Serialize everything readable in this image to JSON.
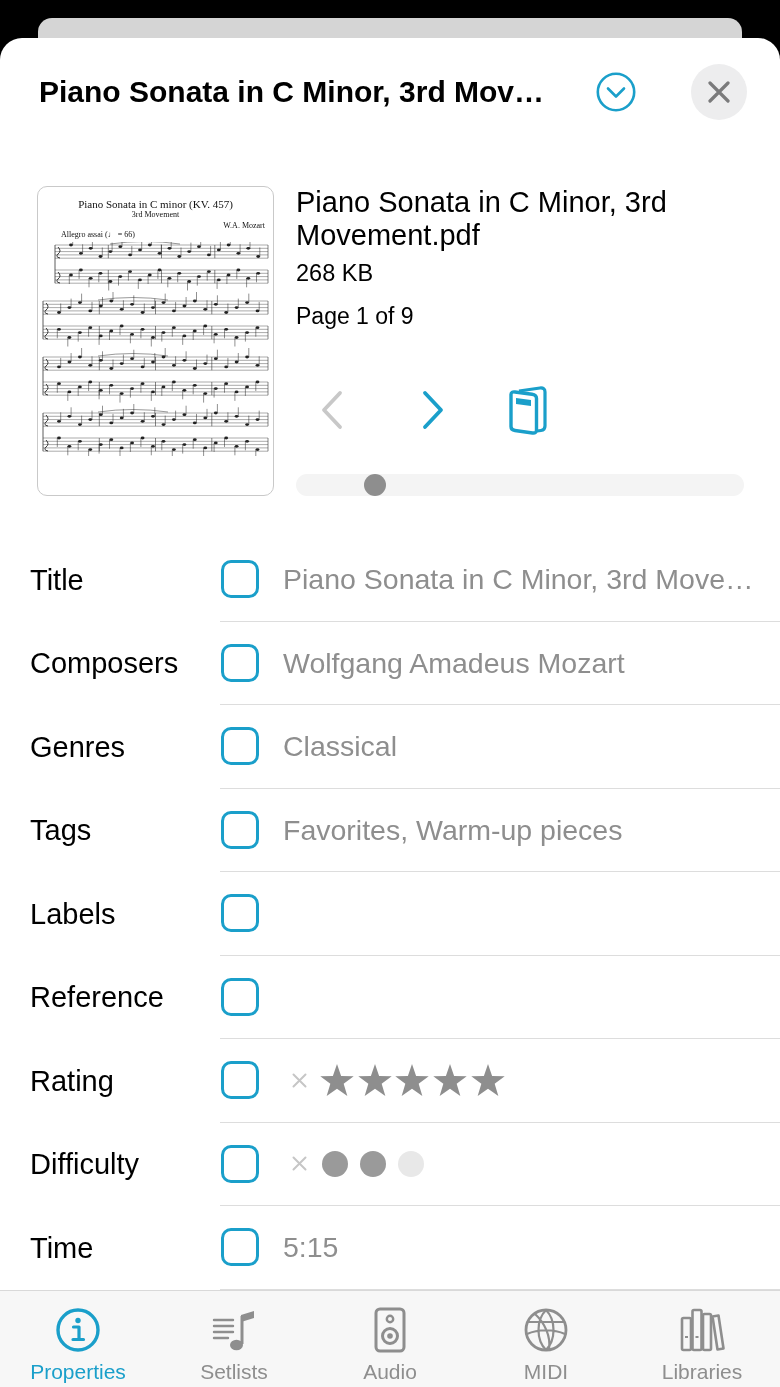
{
  "header": {
    "title": "Piano Sonata in C Minor, 3rd Mov…"
  },
  "document": {
    "thumbnail": {
      "title": "Piano Sonata in C minor (KV. 457)",
      "subtitle": "3rd Movement",
      "composer": "W.A. Mozart",
      "tempo": "Allegro assai (♩ = 66)"
    },
    "filename": "Piano Sonata in C Minor, 3rd Movement.pdf",
    "size": "268 KB",
    "page": "Page 1 of 9",
    "page_buttons": [
      {
        "kind": "previous",
        "disabled": true
      },
      {
        "kind": "next",
        "disabled": false
      }
    ],
    "page_slider": {
      "level": 0.16
    }
  },
  "fields": [
    {
      "label": "Title",
      "kind": "text",
      "checked": false,
      "value": "Piano Sonata in C Minor, 3rd Move…"
    },
    {
      "label": "Composers",
      "kind": "text",
      "checked": false,
      "value": "Wolfgang Amadeus Mozart"
    },
    {
      "label": "Genres",
      "kind": "text",
      "checked": false,
      "value": "Classical"
    },
    {
      "label": "Tags",
      "kind": "text",
      "checked": false,
      "value": "Favorites, Warm-up pieces"
    },
    {
      "label": "Labels",
      "kind": "text",
      "checked": false
    },
    {
      "label": "Reference",
      "kind": "text",
      "checked": false
    },
    {
      "label": "Rating",
      "kind": "stars",
      "checked": false,
      "stars": 5
    },
    {
      "label": "Difficulty",
      "kind": "dots",
      "checked": false,
      "dots": [
        {
          "filled": true
        },
        {
          "filled": true
        },
        {
          "filled": false
        }
      ]
    },
    {
      "label": "Time",
      "kind": "text",
      "checked": false,
      "value": "5:15"
    }
  ],
  "tab_bar": {
    "tabs": [
      {
        "label": "Properties",
        "selected": true
      },
      {
        "label": "Setlists",
        "selected": false
      },
      {
        "label": "Audio",
        "selected": false
      },
      {
        "label": "MIDI",
        "selected": false
      },
      {
        "label": "Libraries",
        "selected": false
      }
    ]
  }
}
